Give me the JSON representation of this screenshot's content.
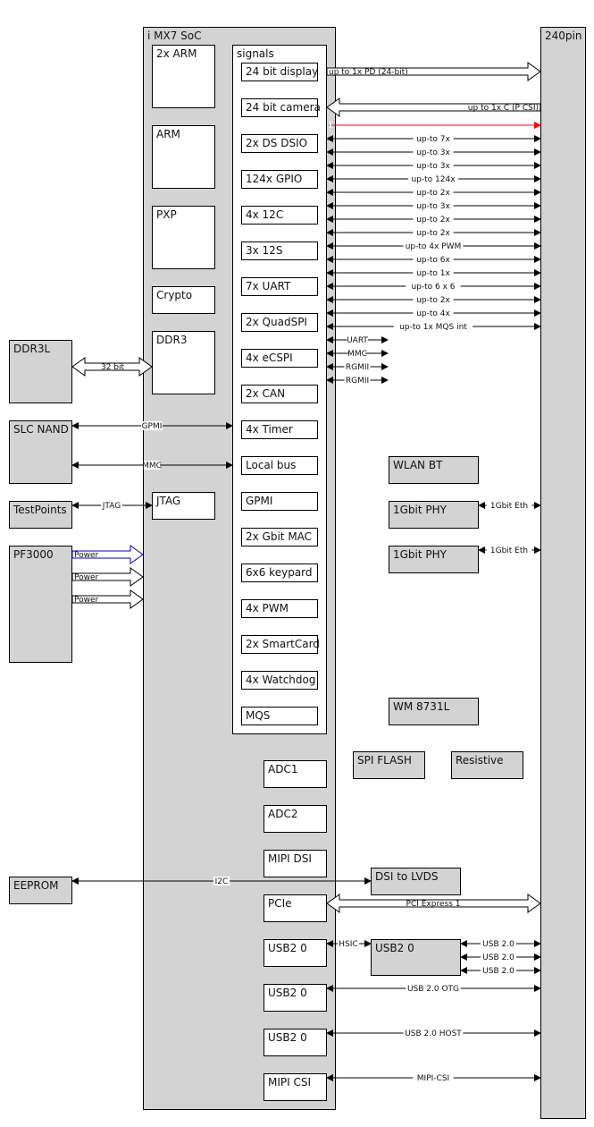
{
  "diagram": {
    "soc": {
      "title": "i MX7 SoC"
    },
    "connector": {
      "title": "240pin"
    },
    "signals_group": {
      "title": "signals"
    },
    "cores": [
      {
        "id": "arm2",
        "label": "2x ARM"
      },
      {
        "id": "arm",
        "label": "ARM"
      },
      {
        "id": "pxp",
        "label": "PXP"
      },
      {
        "id": "crypto",
        "label": "Crypto"
      },
      {
        "id": "ddr3",
        "label": "DDR3"
      },
      {
        "id": "jtag",
        "label": "JTAG"
      }
    ],
    "signals": [
      "24 bit display",
      "24 bit camera",
      "2x DS DSIO",
      "124x GPIO",
      "4x 12C",
      "3x 12S",
      "7x UART",
      "2x QuadSPI",
      "4x eCSPI",
      "2x CAN",
      "4x Timer",
      "Local bus",
      "GPMI",
      "2x Gbit MAC",
      "6x6 keypard",
      "4x PWM",
      "2x SmartCard",
      "4x Watchdog",
      "MQS"
    ],
    "lower_blocks": [
      "ADC1",
      "ADC2",
      "MIPI DSI",
      "PCIe",
      "USB2 0",
      "USB2 0",
      "USB2 0",
      "MIPI CSI"
    ],
    "external_left": [
      "DDR3L",
      "SLC NAND",
      "TestPoints",
      "PF3000",
      "EEPROM"
    ],
    "external_mid": [
      "WLAN BT",
      "1Gbit PHY",
      "1Gbit PHY",
      "WM 8731L",
      "SPI FLASH",
      "Resistive",
      "DSI to LVDS",
      "USB2 0"
    ],
    "wide_arrows": {
      "display": "up to 1x PD (24-bit)",
      "camera": "up to 1x C (P CSI)",
      "ddr": "32 bit",
      "pcie": "PCI Express 1",
      "power": [
        "Power",
        "Power",
        "Power"
      ]
    },
    "bus_lines": [
      "up-to 7x",
      "up-to 3x",
      "up-to 3x",
      "up-to 124x",
      "up-to 2x",
      "up-to 3x",
      "up-to 2x",
      "up-to 2x",
      "up-to 4x PWM",
      "up-to 6x",
      "up-to 1x",
      "up-to 6 x 6",
      "up-to 2x",
      "up-to 4x",
      "up-to 1x MQS int"
    ],
    "short_lines": [
      "UART",
      "MMC",
      "RGMII",
      "RGMII"
    ],
    "eth_lines": [
      "1Gbit Eth",
      "1Gbit Eth"
    ],
    "left_lines": {
      "gpmi": "GPMI",
      "mmc": "MMC",
      "jtag": "JTAG",
      "i2c": "I2C"
    },
    "usb_lines": {
      "hsic": "HSIC",
      "hub": [
        "USB 2.0",
        "USB 2.0",
        "USB 2.0"
      ],
      "otg": "USB 2.0 OTG",
      "host": "USB 2.0 HOST",
      "csi": "MIPI-CSI"
    },
    "colors": {
      "block_fill": "#d3d3d3",
      "inner_fill": "#ffffff",
      "stroke": "#000000",
      "red_line": "#ff0000",
      "power_blue": "#0000cc"
    }
  }
}
